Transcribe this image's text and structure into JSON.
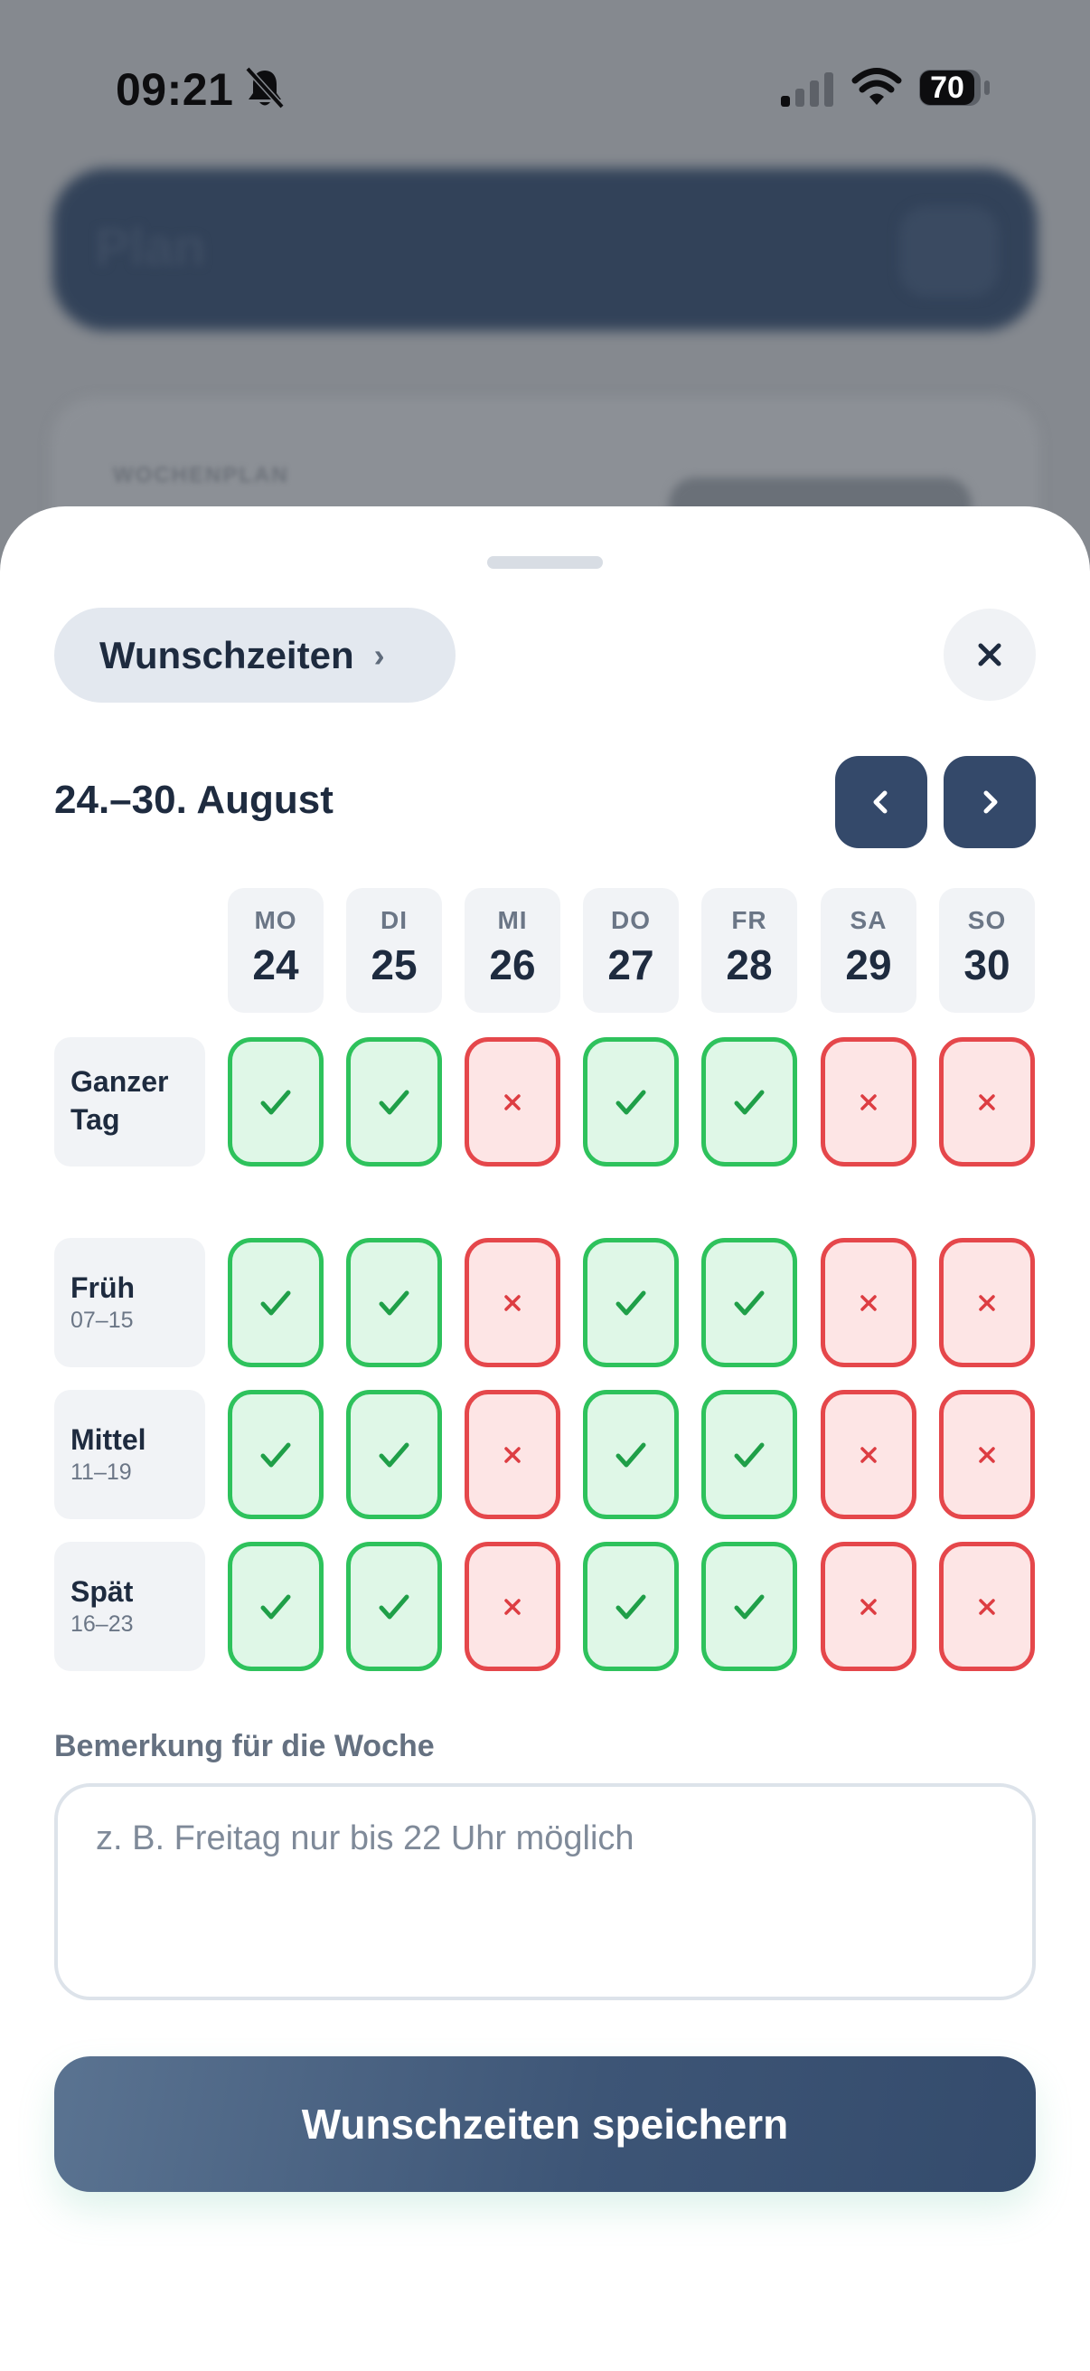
{
  "status_bar": {
    "time": "09:21",
    "battery": "70",
    "icons": [
      "bell-slash-icon",
      "signal-icon",
      "wifi-icon",
      "battery-icon"
    ]
  },
  "background": {
    "header_title": "Plan",
    "card_label": "WOCHENPLAN"
  },
  "sheet": {
    "pill_label": "Wunschzeiten",
    "pill_chevron": "›",
    "week_title": "24.–30. August",
    "days": [
      {
        "abbr": "MO",
        "num": "24"
      },
      {
        "abbr": "DI",
        "num": "25"
      },
      {
        "abbr": "MI",
        "num": "26"
      },
      {
        "abbr": "DO",
        "num": "27"
      },
      {
        "abbr": "FR",
        "num": "28"
      },
      {
        "abbr": "SA",
        "num": "29"
      },
      {
        "abbr": "SO",
        "num": "30"
      }
    ],
    "rows": [
      {
        "name": "Ganzer",
        "name2": "Tag",
        "time": "",
        "values": [
          true,
          true,
          false,
          true,
          true,
          false,
          false
        ]
      },
      {
        "name": "Früh",
        "name2": "",
        "time": "07–15",
        "values": [
          true,
          true,
          false,
          true,
          true,
          false,
          false
        ]
      },
      {
        "name": "Mittel",
        "name2": "",
        "time": "11–19",
        "values": [
          true,
          true,
          false,
          true,
          true,
          false,
          false
        ]
      },
      {
        "name": "Spät",
        "name2": "",
        "time": "16–23",
        "values": [
          true,
          true,
          false,
          true,
          true,
          false,
          false
        ]
      }
    ],
    "note": {
      "label": "Bemerkung für die Woche",
      "placeholder": "z. B. Freitag nur bis 22 Uhr möglich",
      "value": ""
    },
    "save_label": "Wunschzeiten speichern"
  },
  "colors": {
    "primary": "#34496a",
    "yes_border": "#2ec25c",
    "yes_fill": "#dff7e7",
    "no_border": "#e5474b",
    "no_fill": "#fde5e5",
    "text_dark": "#1e2b3f"
  }
}
